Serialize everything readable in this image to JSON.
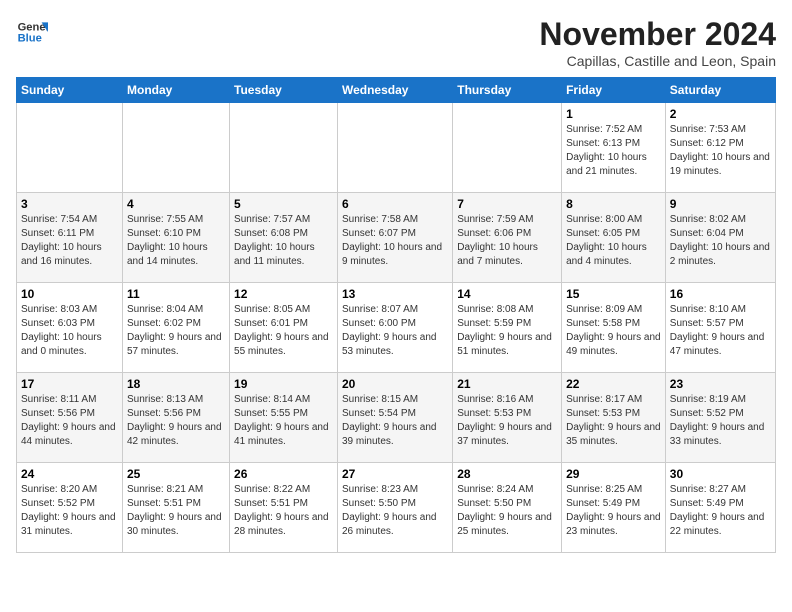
{
  "logo": {
    "line1": "General",
    "line2": "Blue"
  },
  "title": "November 2024",
  "subtitle": "Capillas, Castille and Leon, Spain",
  "weekdays": [
    "Sunday",
    "Monday",
    "Tuesday",
    "Wednesday",
    "Thursday",
    "Friday",
    "Saturday"
  ],
  "weeks": [
    [
      {
        "day": "",
        "info": ""
      },
      {
        "day": "",
        "info": ""
      },
      {
        "day": "",
        "info": ""
      },
      {
        "day": "",
        "info": ""
      },
      {
        "day": "",
        "info": ""
      },
      {
        "day": "1",
        "info": "Sunrise: 7:52 AM\nSunset: 6:13 PM\nDaylight: 10 hours and 21 minutes."
      },
      {
        "day": "2",
        "info": "Sunrise: 7:53 AM\nSunset: 6:12 PM\nDaylight: 10 hours and 19 minutes."
      }
    ],
    [
      {
        "day": "3",
        "info": "Sunrise: 7:54 AM\nSunset: 6:11 PM\nDaylight: 10 hours and 16 minutes."
      },
      {
        "day": "4",
        "info": "Sunrise: 7:55 AM\nSunset: 6:10 PM\nDaylight: 10 hours and 14 minutes."
      },
      {
        "day": "5",
        "info": "Sunrise: 7:57 AM\nSunset: 6:08 PM\nDaylight: 10 hours and 11 minutes."
      },
      {
        "day": "6",
        "info": "Sunrise: 7:58 AM\nSunset: 6:07 PM\nDaylight: 10 hours and 9 minutes."
      },
      {
        "day": "7",
        "info": "Sunrise: 7:59 AM\nSunset: 6:06 PM\nDaylight: 10 hours and 7 minutes."
      },
      {
        "day": "8",
        "info": "Sunrise: 8:00 AM\nSunset: 6:05 PM\nDaylight: 10 hours and 4 minutes."
      },
      {
        "day": "9",
        "info": "Sunrise: 8:02 AM\nSunset: 6:04 PM\nDaylight: 10 hours and 2 minutes."
      }
    ],
    [
      {
        "day": "10",
        "info": "Sunrise: 8:03 AM\nSunset: 6:03 PM\nDaylight: 10 hours and 0 minutes."
      },
      {
        "day": "11",
        "info": "Sunrise: 8:04 AM\nSunset: 6:02 PM\nDaylight: 9 hours and 57 minutes."
      },
      {
        "day": "12",
        "info": "Sunrise: 8:05 AM\nSunset: 6:01 PM\nDaylight: 9 hours and 55 minutes."
      },
      {
        "day": "13",
        "info": "Sunrise: 8:07 AM\nSunset: 6:00 PM\nDaylight: 9 hours and 53 minutes."
      },
      {
        "day": "14",
        "info": "Sunrise: 8:08 AM\nSunset: 5:59 PM\nDaylight: 9 hours and 51 minutes."
      },
      {
        "day": "15",
        "info": "Sunrise: 8:09 AM\nSunset: 5:58 PM\nDaylight: 9 hours and 49 minutes."
      },
      {
        "day": "16",
        "info": "Sunrise: 8:10 AM\nSunset: 5:57 PM\nDaylight: 9 hours and 47 minutes."
      }
    ],
    [
      {
        "day": "17",
        "info": "Sunrise: 8:11 AM\nSunset: 5:56 PM\nDaylight: 9 hours and 44 minutes."
      },
      {
        "day": "18",
        "info": "Sunrise: 8:13 AM\nSunset: 5:56 PM\nDaylight: 9 hours and 42 minutes."
      },
      {
        "day": "19",
        "info": "Sunrise: 8:14 AM\nSunset: 5:55 PM\nDaylight: 9 hours and 41 minutes."
      },
      {
        "day": "20",
        "info": "Sunrise: 8:15 AM\nSunset: 5:54 PM\nDaylight: 9 hours and 39 minutes."
      },
      {
        "day": "21",
        "info": "Sunrise: 8:16 AM\nSunset: 5:53 PM\nDaylight: 9 hours and 37 minutes."
      },
      {
        "day": "22",
        "info": "Sunrise: 8:17 AM\nSunset: 5:53 PM\nDaylight: 9 hours and 35 minutes."
      },
      {
        "day": "23",
        "info": "Sunrise: 8:19 AM\nSunset: 5:52 PM\nDaylight: 9 hours and 33 minutes."
      }
    ],
    [
      {
        "day": "24",
        "info": "Sunrise: 8:20 AM\nSunset: 5:52 PM\nDaylight: 9 hours and 31 minutes."
      },
      {
        "day": "25",
        "info": "Sunrise: 8:21 AM\nSunset: 5:51 PM\nDaylight: 9 hours and 30 minutes."
      },
      {
        "day": "26",
        "info": "Sunrise: 8:22 AM\nSunset: 5:51 PM\nDaylight: 9 hours and 28 minutes."
      },
      {
        "day": "27",
        "info": "Sunrise: 8:23 AM\nSunset: 5:50 PM\nDaylight: 9 hours and 26 minutes."
      },
      {
        "day": "28",
        "info": "Sunrise: 8:24 AM\nSunset: 5:50 PM\nDaylight: 9 hours and 25 minutes."
      },
      {
        "day": "29",
        "info": "Sunrise: 8:25 AM\nSunset: 5:49 PM\nDaylight: 9 hours and 23 minutes."
      },
      {
        "day": "30",
        "info": "Sunrise: 8:27 AM\nSunset: 5:49 PM\nDaylight: 9 hours and 22 minutes."
      }
    ]
  ]
}
